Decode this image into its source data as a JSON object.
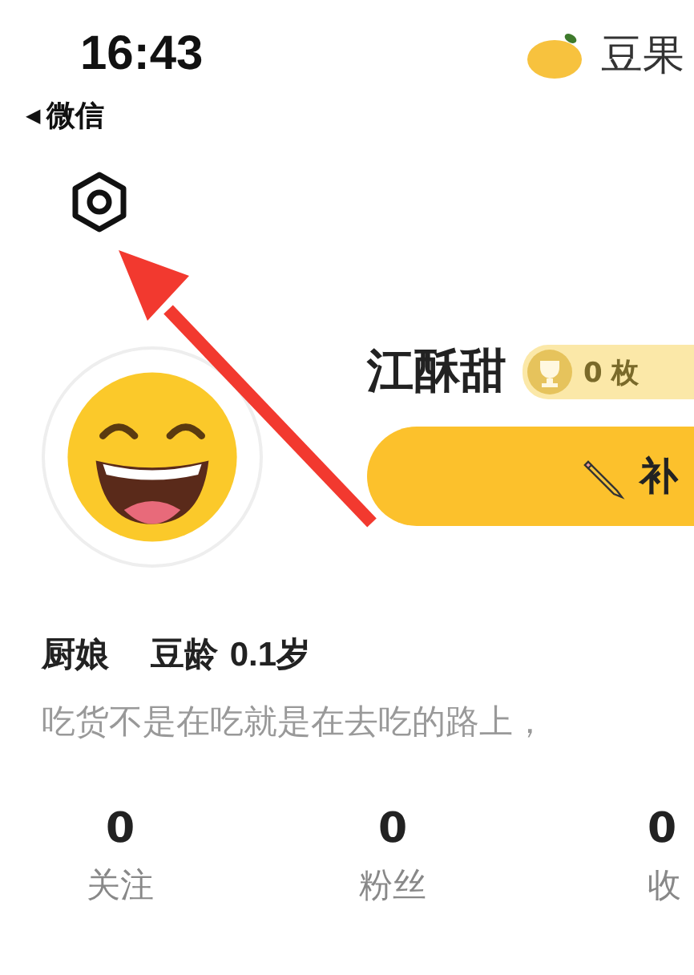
{
  "status_bar": {
    "time": "16:43"
  },
  "app_logo": {
    "text": "豆果"
  },
  "back_link": {
    "icon": "◀",
    "label": "微信"
  },
  "profile": {
    "name": "江酥甜",
    "badge_count": "0 枚",
    "edit_button": "补",
    "title": "厨娘",
    "age_label": "豆龄",
    "age_value": "0.1",
    "age_unit": "岁",
    "bio": "吃货不是在吃就是在去吃的路上，"
  },
  "stats": [
    {
      "value": "0",
      "label": "关注"
    },
    {
      "value": "0",
      "label": "粉丝"
    },
    {
      "value": "0",
      "label": "收"
    }
  ]
}
